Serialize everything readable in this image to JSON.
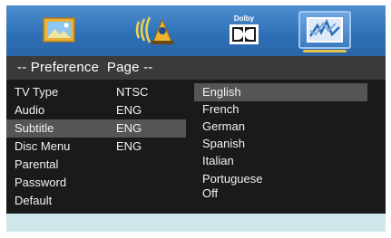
{
  "icons": [
    {
      "name": "general-setup-icon",
      "selected": false
    },
    {
      "name": "audio-setup-icon",
      "selected": false
    },
    {
      "name": "dolby-digital-icon",
      "selected": false,
      "text": "Dolby"
    },
    {
      "name": "preference-icon",
      "selected": true
    }
  ],
  "title": "-- Preference  Page --",
  "settings": [
    {
      "label": "TV Type",
      "value": "NTSC"
    },
    {
      "label": "Audio",
      "value": "ENG"
    },
    {
      "label": "Subtitle",
      "value": "ENG"
    },
    {
      "label": "Disc Menu",
      "value": "ENG"
    },
    {
      "label": "Parental",
      "value": ""
    },
    {
      "label": "Password",
      "value": ""
    },
    {
      "label": "Default",
      "value": ""
    }
  ],
  "highlighted_setting": "Subtitle",
  "options": [
    "English",
    "French",
    "German",
    "Spanish",
    "Italian",
    "Portuguese",
    "Off"
  ],
  "highlighted_option": "English",
  "colors": {
    "topbar": "#2c6fb5",
    "panel": "#1a1a1a",
    "highlight": "#555555",
    "footer": "#cfe6ea",
    "accent": "#e6c24a"
  }
}
